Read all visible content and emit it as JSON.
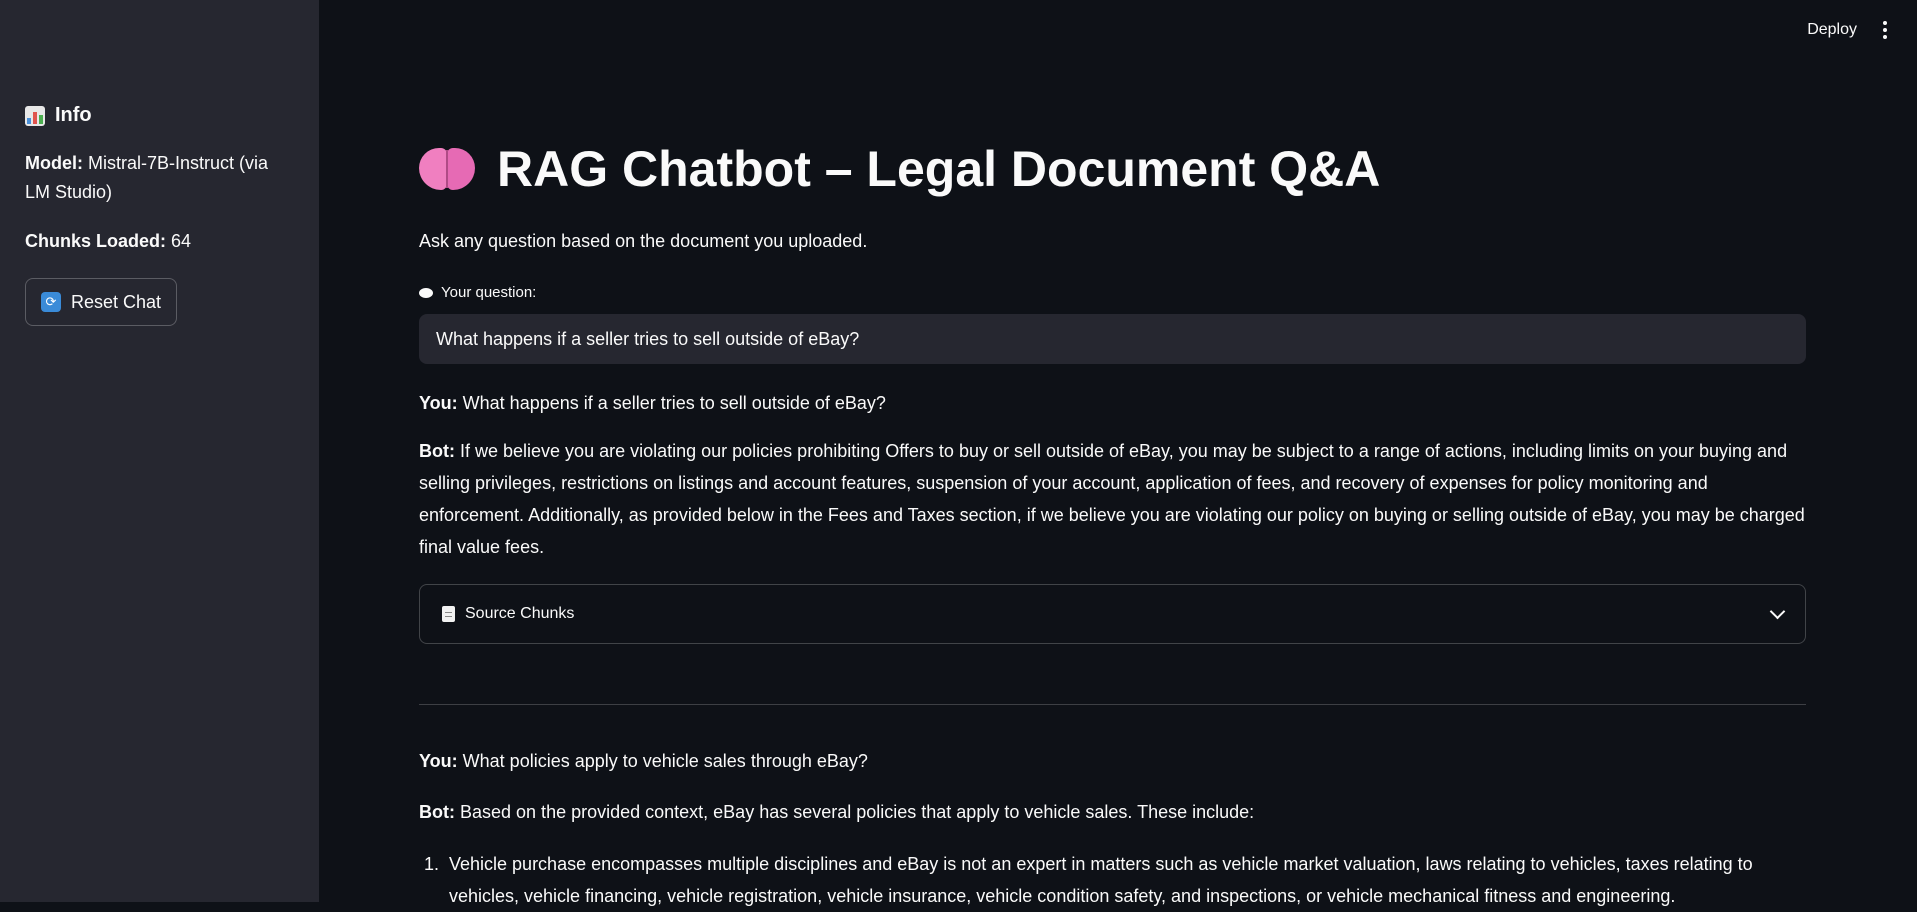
{
  "sidebar": {
    "title": "Info",
    "model_label": "Model:",
    "model_value": "Mistral-7B-Instruct (via LM Studio)",
    "chunks_label": "Chunks Loaded:",
    "chunks_value": "64",
    "reset_label": "Reset Chat"
  },
  "topbar": {
    "deploy_label": "Deploy"
  },
  "main": {
    "title": "RAG Chatbot – Legal Document Q&A",
    "subtitle": "Ask any question based on the document you uploaded.",
    "question_label": "Your question:",
    "question_value": "What happens if a seller tries to sell outside of eBay?"
  },
  "conversation": [
    {
      "user_label": "You:",
      "user_text": "What happens if a seller tries to sell outside of eBay?",
      "bot_label": "Bot:",
      "bot_text": "If we believe you are violating our policies prohibiting Offers to buy or sell outside of eBay, you may be subject to a range of actions, including limits on your buying and selling privileges, restrictions on listings and account features, suspension of your account, application of fees, and recovery of expenses for policy monitoring and enforcement. Additionally, as provided below in the Fees and Taxes section, if we believe you are violating our policy on buying or selling outside of eBay, you may be charged final value fees.",
      "expander_label": "Source Chunks"
    },
    {
      "user_label": "You:",
      "user_text": "What policies apply to vehicle sales through eBay?",
      "bot_label": "Bot:",
      "bot_text": "Based on the provided context, eBay has several policies that apply to vehicle sales. These include:",
      "list": [
        {
          "num": "1.",
          "text": "Vehicle purchase encompasses multiple disciplines and eBay is not an expert in matters such as vehicle market valuation, laws relating to vehicles, taxes relating to vehicles, vehicle financing, vehicle registration, vehicle insurance, vehicle condition safety, and inspections, or vehicle mechanical fitness and engineering."
        }
      ]
    }
  ]
}
